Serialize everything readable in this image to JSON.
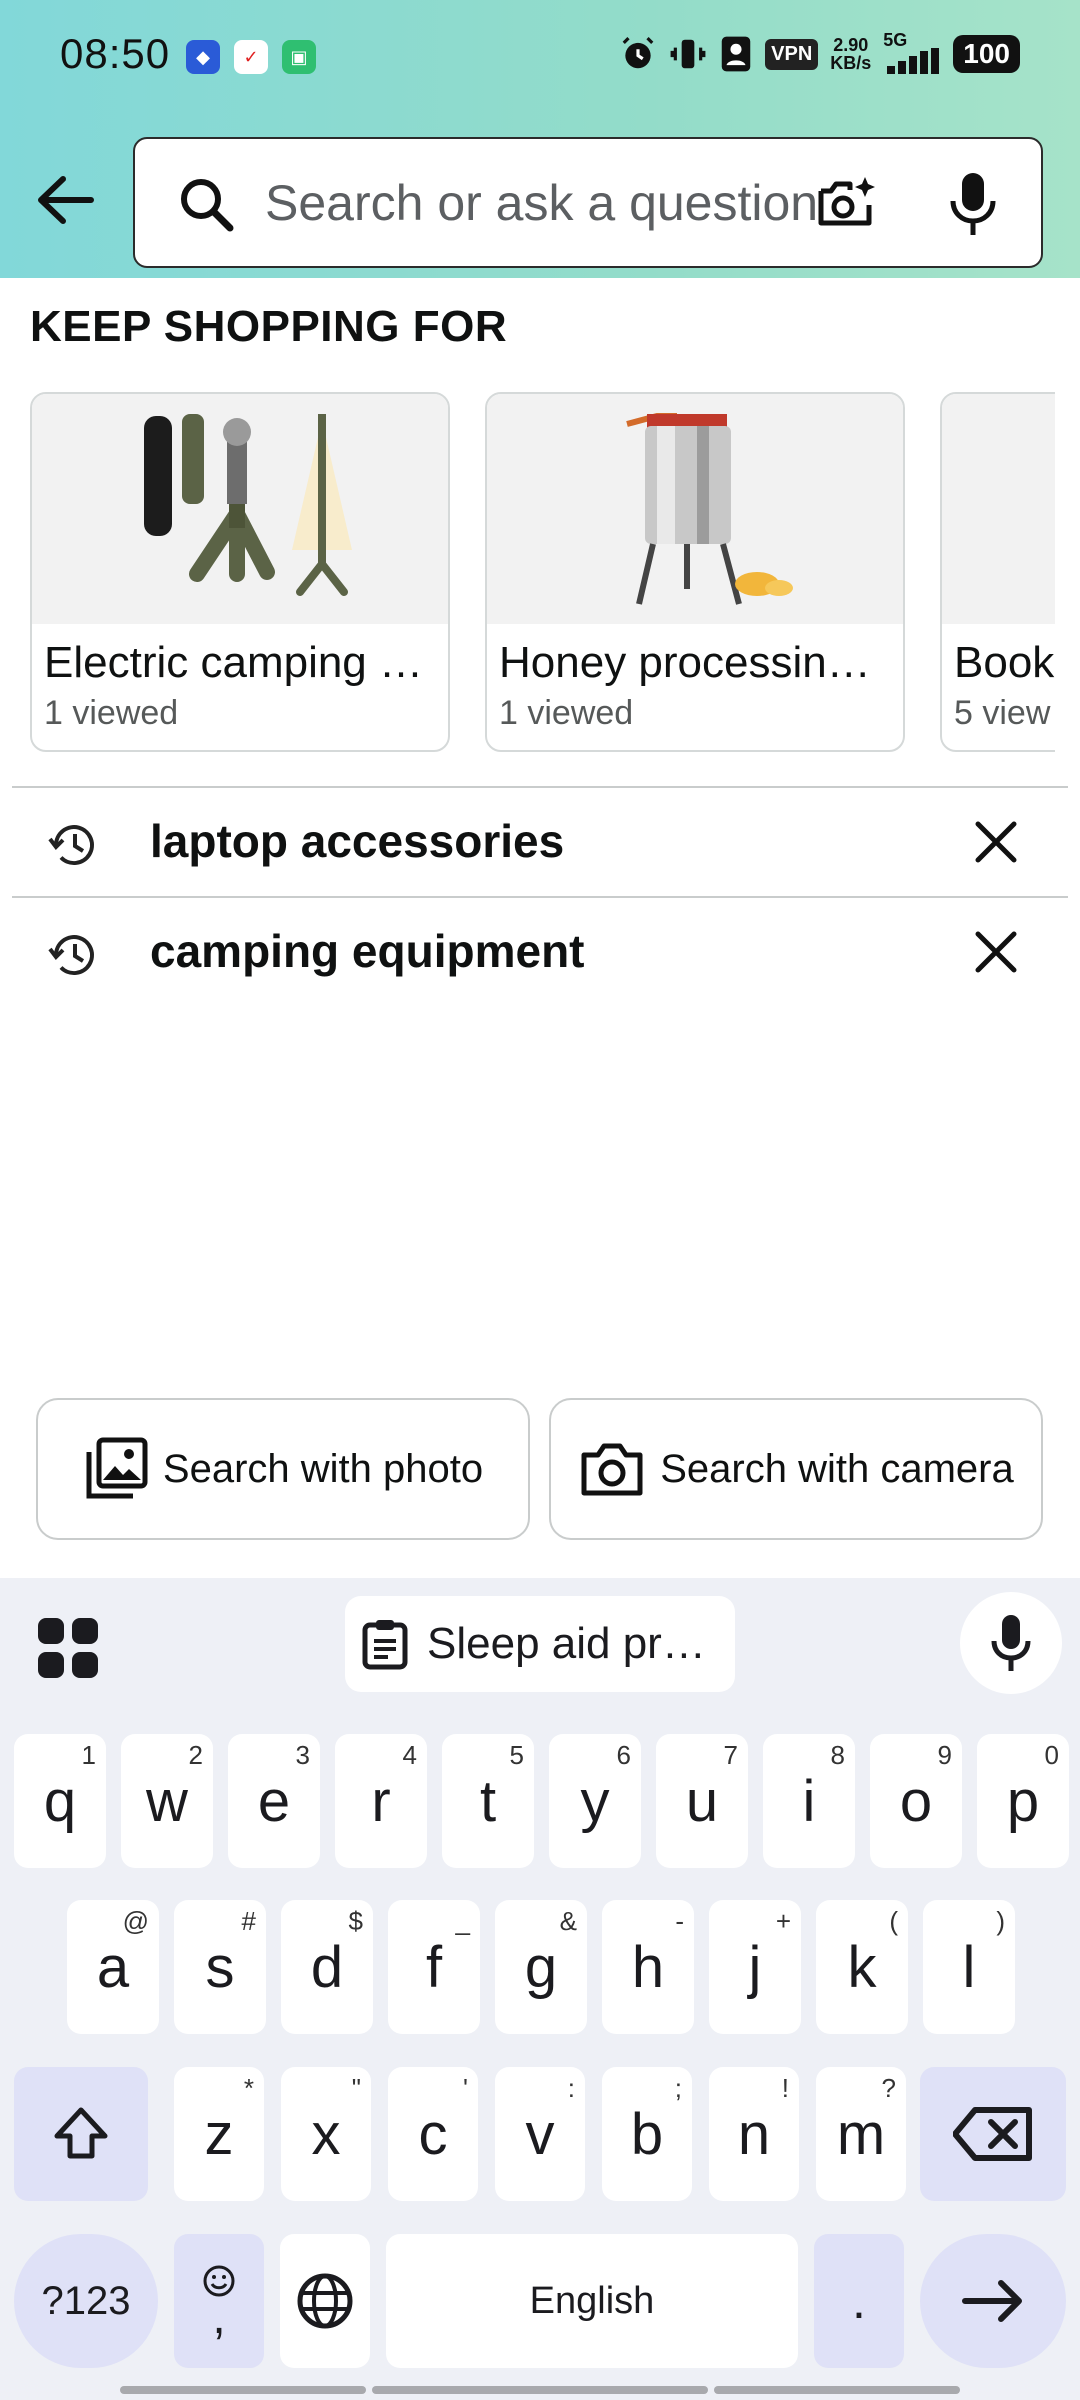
{
  "status_bar": {
    "time": "08:50",
    "vpn": "VPN",
    "speed_value": "2.90",
    "speed_unit": "KB/s",
    "network": "5G",
    "battery": "100"
  },
  "search": {
    "placeholder": "Search or ask a question",
    "value": ""
  },
  "keep_shopping": {
    "title": "KEEP SHOPPING FOR",
    "items": [
      {
        "title": "Electric camping …",
        "subtitle": "1 viewed"
      },
      {
        "title": "Honey processin…",
        "subtitle": "1 viewed"
      },
      {
        "title": "Book",
        "subtitle": "5 view"
      }
    ]
  },
  "history": [
    {
      "label": "laptop accessories"
    },
    {
      "label": "camping equipment"
    }
  ],
  "actions": {
    "photo_label": "Search with photo",
    "camera_label": "Search with camera"
  },
  "keyboard": {
    "clipboard_chip": "Sleep aid pr…",
    "row1": [
      {
        "k": "q",
        "s": "1"
      },
      {
        "k": "w",
        "s": "2"
      },
      {
        "k": "e",
        "s": "3"
      },
      {
        "k": "r",
        "s": "4"
      },
      {
        "k": "t",
        "s": "5"
      },
      {
        "k": "y",
        "s": "6"
      },
      {
        "k": "u",
        "s": "7"
      },
      {
        "k": "i",
        "s": "8"
      },
      {
        "k": "o",
        "s": "9"
      },
      {
        "k": "p",
        "s": "0"
      }
    ],
    "row2": [
      {
        "k": "a",
        "s": "@"
      },
      {
        "k": "s",
        "s": "#"
      },
      {
        "k": "d",
        "s": "$"
      },
      {
        "k": "f",
        "s": "_"
      },
      {
        "k": "g",
        "s": "&"
      },
      {
        "k": "h",
        "s": "-"
      },
      {
        "k": "j",
        "s": "+"
      },
      {
        "k": "k",
        "s": "("
      },
      {
        "k": "l",
        "s": ")"
      }
    ],
    "row3": [
      {
        "k": "z",
        "s": "*"
      },
      {
        "k": "x",
        "s": "\""
      },
      {
        "k": "c",
        "s": "'"
      },
      {
        "k": "v",
        "s": ":"
      },
      {
        "k": "b",
        "s": ";"
      },
      {
        "k": "n",
        "s": "!"
      },
      {
        "k": "m",
        "s": "?"
      }
    ],
    "symbols_label": "?123",
    "emoji_comma_label": ",",
    "space_label": "English",
    "period_label": "."
  },
  "colors": {
    "header_start": "#82d8d9",
    "header_end": "#a6e3c9",
    "keyboard_bg": "#eef0f6",
    "modifier_key": "#dfe1f7"
  }
}
